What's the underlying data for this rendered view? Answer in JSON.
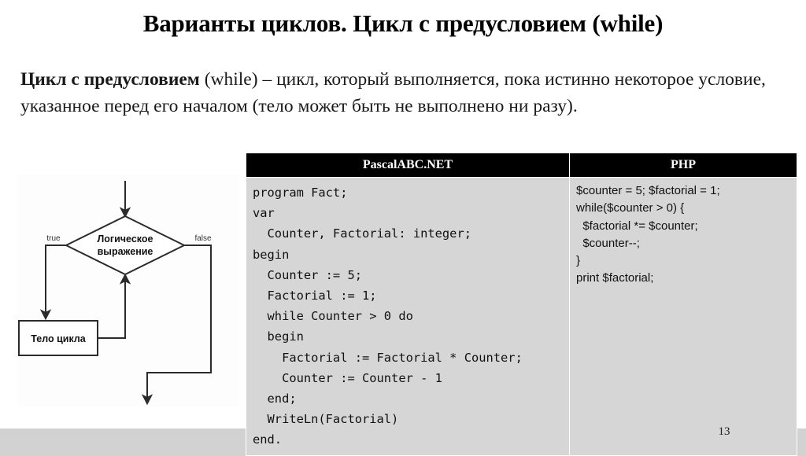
{
  "slide": {
    "title": "Варианты циклов. Цикл с предусловием (while)",
    "page_number": "13",
    "intro": {
      "term": "Цикл с предусловием",
      "definition": " (while) – цикл, который выполняется, пока истинно некоторое условие, указанное перед его началом (тело может быть не выполнено ни разу)."
    }
  },
  "flowchart": {
    "condition_line1": "Логическое",
    "condition_line2": "выражение",
    "label_true": "true",
    "label_false": "false",
    "body_label": "Тело цикла",
    "stroke_color": "#2b2b2b",
    "fill_color": "#ffffff"
  },
  "code_table": {
    "headers": [
      "PascalABC.NET",
      "PHP"
    ],
    "cells": [
      "program Fact;\nvar\n  Counter, Factorial: integer;\nbegin\n  Counter := 5;\n  Factorial := 1;\n  while Counter > 0 do\n  begin\n    Factorial := Factorial * Counter;\n    Counter := Counter - 1\n  end;\n  WriteLn(Factorial)\nend.",
      "$counter = 5; $factorial = 1;\nwhile($counter > 0) {\n  $factorial *= $counter;\n  $counter--;\n}\nprint $factorial;"
    ],
    "header_bg": "#000000",
    "cell_bg": "#d6d6d6"
  }
}
